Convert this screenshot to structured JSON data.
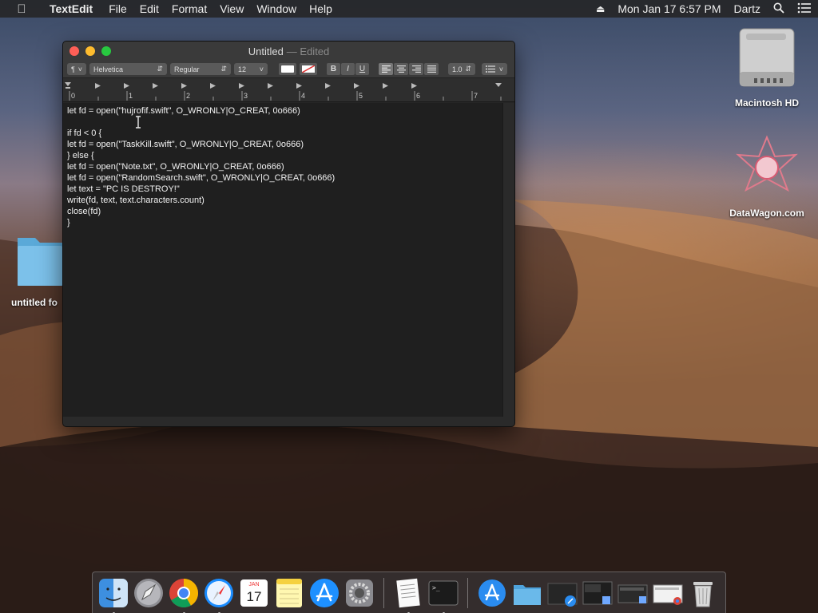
{
  "menubar": {
    "app_name": "TextEdit",
    "items": [
      "File",
      "Edit",
      "Format",
      "View",
      "Window",
      "Help"
    ],
    "datetime": "Mon Jan 17  6:57 PM",
    "user": "Dartz"
  },
  "desktop": {
    "icons": [
      {
        "label": "Macintosh HD"
      },
      {
        "label": "DataWagon.com"
      },
      {
        "label": "untitled fo"
      }
    ]
  },
  "window": {
    "title": "Untitled",
    "title_suffix": "— Edited",
    "toolbar": {
      "paragraph_style": "¶",
      "font_family": "Helvetica",
      "font_style": "Regular",
      "font_size": "12",
      "bold": "B",
      "italic": "I",
      "underline": "U",
      "line_spacing": "1.0"
    },
    "ruler_numbers": [
      "0",
      "1",
      "2",
      "3",
      "4",
      "5",
      "6",
      "7"
    ],
    "document_lines": [
      "let fd = open(\"hujrofif.swift\", O_WRONLY|O_CREAT, 0o666)",
      "",
      "if fd < 0 {",
      "let fd = open(\"TaskKill.swift\", O_WRONLY|O_CREAT, 0o666)",
      "} else {",
      "let fd = open(\"Note.txt\", O_WRONLY|O_CREAT, 0o666)",
      "let fd = open(\"RandomSearch.swift\", O_WRONLY|O_CREAT, 0o666)",
      "let text = \"PC IS DESTROY!\"",
      "write(fd, text, text.characters.count)",
      "close(fd)",
      "}"
    ]
  },
  "dock": {
    "calendar_month": "JAN",
    "calendar_day": "17"
  },
  "colors": {
    "close": "#fe5f57",
    "minimize": "#febc2e",
    "zoom": "#28c840"
  }
}
